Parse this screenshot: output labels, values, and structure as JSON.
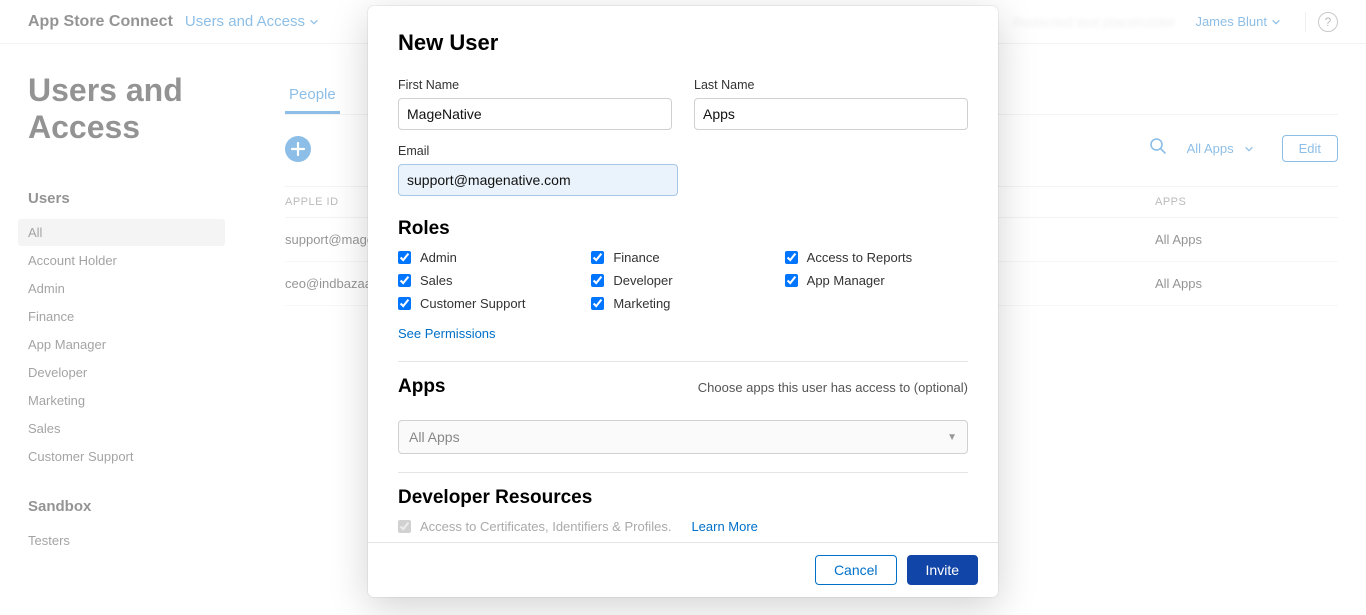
{
  "topbar": {
    "brand": "App Store Connect",
    "breadcrumb": "Users and Access",
    "username": "James Blunt"
  },
  "page": {
    "title": "Users and Access",
    "tab_people": "People"
  },
  "sidebar": {
    "heading1": "Users",
    "items": [
      "All",
      "Account Holder",
      "Admin",
      "Finance",
      "App Manager",
      "Developer",
      "Marketing",
      "Sales",
      "Customer Support"
    ],
    "heading2": "Sandbox",
    "items2": [
      "Testers"
    ]
  },
  "toolbar": {
    "filter": "All Apps",
    "edit": "Edit"
  },
  "table": {
    "header_id": "APPLE ID",
    "header_apps": "APPS",
    "rows": [
      {
        "id": "support@magenative.co",
        "apps": "All Apps"
      },
      {
        "id": "ceo@indbazaar.in",
        "apps": "All Apps"
      }
    ]
  },
  "modal": {
    "title": "New User",
    "first_name_label": "First Name",
    "first_name": "MageNative",
    "last_name_label": "Last Name",
    "last_name": "Apps",
    "email_label": "Email",
    "email": "support@magenative.com",
    "roles_heading": "Roles",
    "roles": [
      {
        "label": "Admin",
        "checked": true
      },
      {
        "label": "Finance",
        "checked": true
      },
      {
        "label": "Access to Reports",
        "checked": true
      },
      {
        "label": "Sales",
        "checked": true
      },
      {
        "label": "Developer",
        "checked": true
      },
      {
        "label": "App Manager",
        "checked": true
      },
      {
        "label": "Customer Support",
        "checked": true
      },
      {
        "label": "Marketing",
        "checked": true
      }
    ],
    "see_permissions": "See Permissions",
    "apps_heading": "Apps",
    "apps_hint": "Choose apps this user has access to (optional)",
    "apps_select": "All Apps",
    "devres_heading": "Developer Resources",
    "devres_option": "Access to Certificates, Identifiers & Profiles.",
    "learn_more": "Learn More",
    "cancel": "Cancel",
    "invite": "Invite"
  }
}
